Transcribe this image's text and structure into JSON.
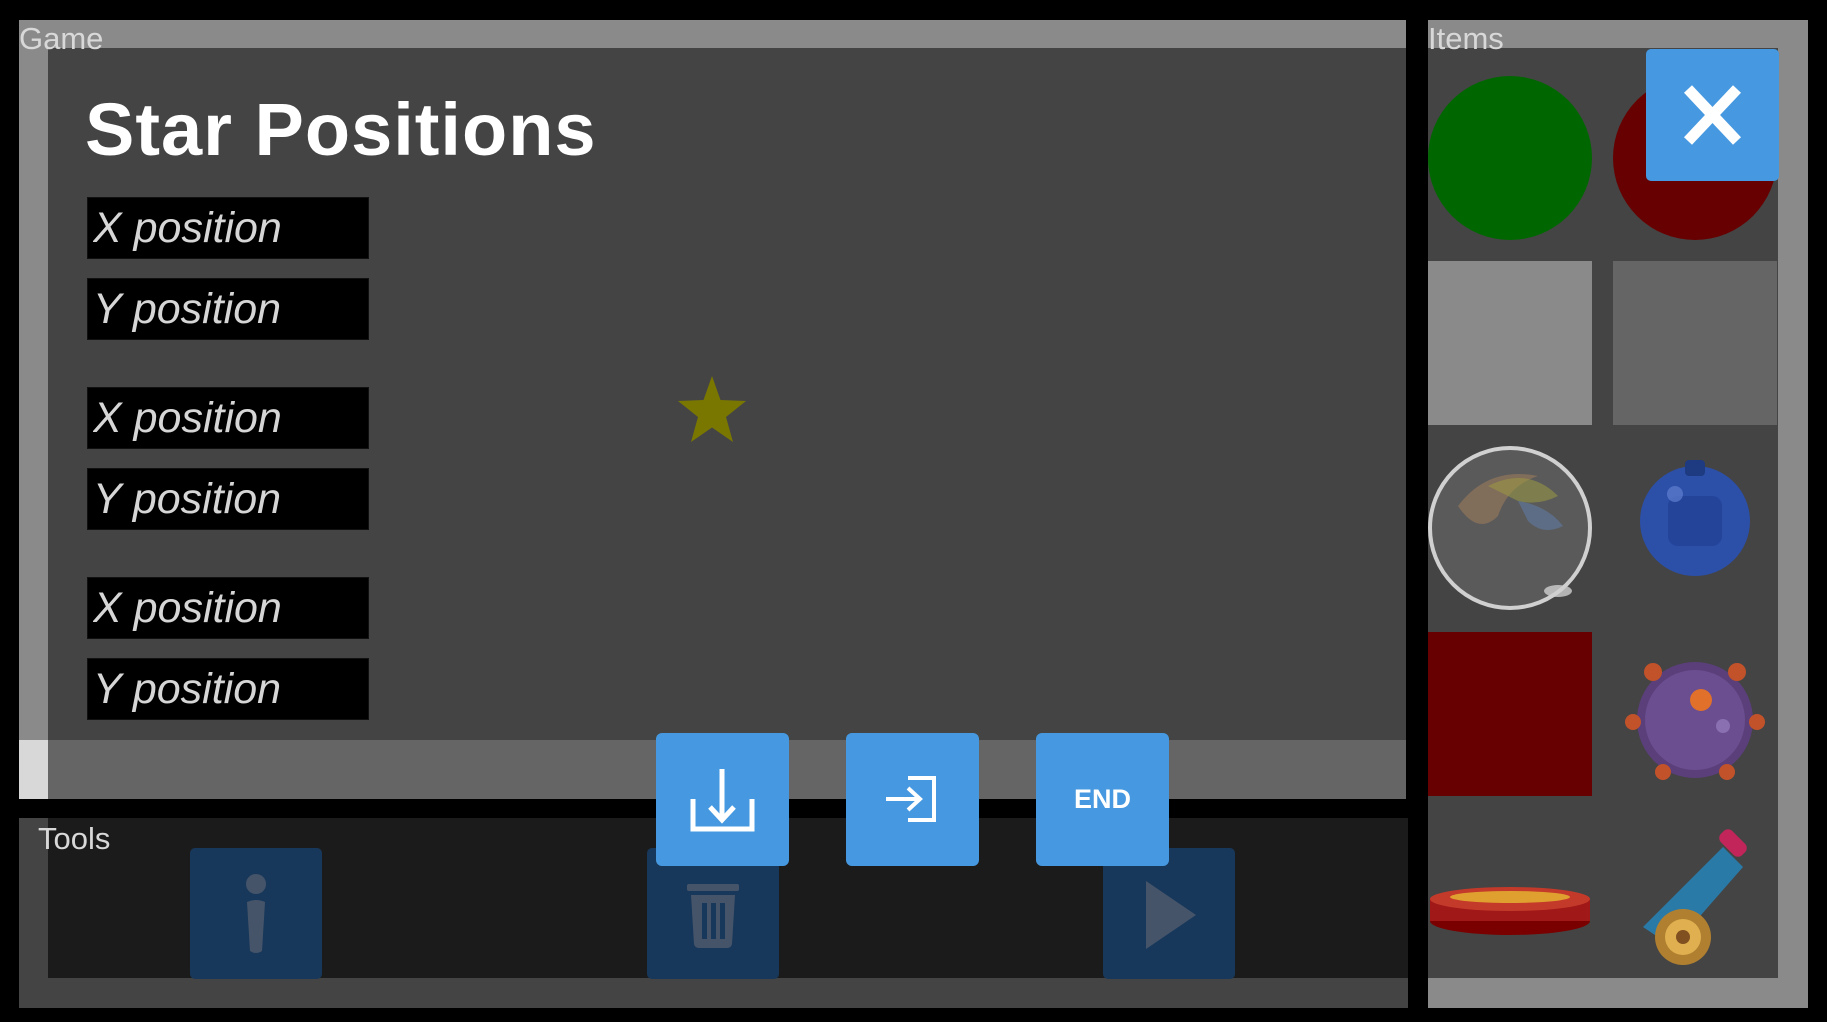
{
  "panels": {
    "game_title": "Game",
    "tools_title": "Tools",
    "items_title": "Items"
  },
  "star_positions": {
    "title": "Star Positions",
    "inputs": [
      {
        "x_placeholder": "X position",
        "y_placeholder": "Y position"
      },
      {
        "x_placeholder": "X position",
        "y_placeholder": "Y position"
      },
      {
        "x_placeholder": "X position",
        "y_placeholder": "Y position"
      }
    ]
  },
  "overlay_buttons": {
    "save_icon": "download-icon",
    "load_icon": "login-icon",
    "end_label": "END"
  },
  "tools": [
    {
      "icon": "info-icon"
    },
    {
      "icon": "trash-icon"
    },
    {
      "icon": "play-icon"
    }
  ],
  "items": [
    {
      "name": "green-circle"
    },
    {
      "name": "red-circle"
    },
    {
      "name": "gray-square"
    },
    {
      "name": "gray-square"
    },
    {
      "name": "bubble"
    },
    {
      "name": "blue-bomb"
    },
    {
      "name": "red-square"
    },
    {
      "name": "spiked-mine"
    },
    {
      "name": "spring-pad"
    },
    {
      "name": "cannon"
    }
  ],
  "colors": {
    "accent": "#4699e0",
    "star": "#7a7700",
    "canvas": "#444444"
  },
  "close_icon": "close-icon"
}
